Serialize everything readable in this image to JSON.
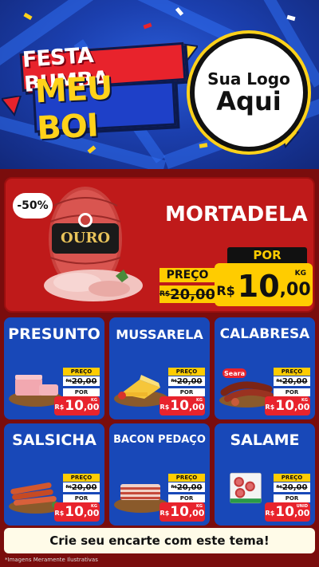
{
  "header": {
    "title_line1": "FESTA BUMBA",
    "title_line2": "MEU BOI",
    "logo_line1": "Sua Logo",
    "logo_line2": "Aqui"
  },
  "feature": {
    "badge": "-50%",
    "name": "MORTADELA",
    "brand_text": "OURO",
    "old_label": "PREÇO",
    "old_currency": "R$",
    "old_price": "20,00",
    "new_label": "POR",
    "new_currency": "R$",
    "new_int": "10",
    "new_cents": ",00",
    "unit": "KG"
  },
  "products": [
    {
      "name": "PRESUNTO",
      "old_label": "PREÇO",
      "old_currency": "R$",
      "old_price": "20,00",
      "new_label": "POR",
      "currency": "R$",
      "int": "10",
      "cents": ",00",
      "unit": "KG"
    },
    {
      "name": "MUSSARELA",
      "old_label": "PREÇO",
      "old_currency": "R$",
      "old_price": "20,00",
      "new_label": "POR",
      "currency": "R$",
      "int": "10",
      "cents": ",00",
      "unit": "KG"
    },
    {
      "name": "CALABRESA",
      "old_label": "PREÇO",
      "old_currency": "R$",
      "old_price": "20,00",
      "new_label": "POR",
      "currency": "R$",
      "int": "10",
      "cents": ",00",
      "unit": "KG",
      "brand_text": "Seara"
    },
    {
      "name": "SALSICHA",
      "old_label": "PREÇO",
      "old_currency": "R$",
      "old_price": "20,00",
      "new_label": "POR",
      "currency": "R$",
      "int": "10",
      "cents": ",00",
      "unit": "KG"
    },
    {
      "name": "BACON PEDAÇO",
      "old_label": "PREÇO",
      "old_currency": "R$",
      "old_price": "20,00",
      "new_label": "POR",
      "currency": "R$",
      "int": "10",
      "cents": ",00",
      "unit": "KG"
    },
    {
      "name": "SALAME",
      "old_label": "PREÇO",
      "old_currency": "R$",
      "old_price": "20,00",
      "new_label": "POR",
      "currency": "R$",
      "int": "10",
      "cents": ",00",
      "unit": "UNID"
    }
  ],
  "footer": {
    "cta": "Crie seu encarte com este tema!",
    "disclaimer": "*Imagens Meramente Ilustrativas"
  },
  "colors": {
    "header_blue": "#1b3fae",
    "card_blue": "#1848b8",
    "feature_red": "#bf1a1a",
    "price_yellow": "#ffcc00",
    "price_red": "#e8232c",
    "background": "#7a0d0d"
  }
}
